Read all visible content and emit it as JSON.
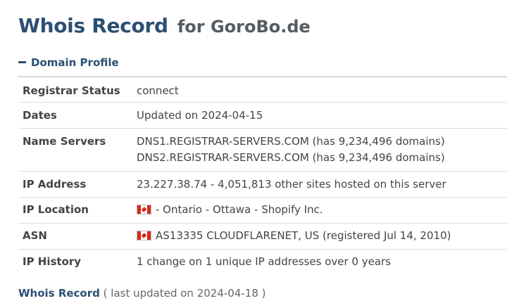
{
  "title": {
    "main": "Whois Record",
    "sub": "for GoroBo.de"
  },
  "section": {
    "label": "Domain Profile",
    "icon": "minus-icon"
  },
  "rows": {
    "registrar_status": {
      "label": "Registrar Status",
      "value": "connect"
    },
    "dates": {
      "label": "Dates",
      "value": "Updated on 2024-04-15"
    },
    "name_servers": {
      "label": "Name Servers",
      "values": [
        "DNS1.REGISTRAR-SERVERS.COM (has 9,234,496 domains)",
        "DNS2.REGISTRAR-SERVERS.COM (has 9,234,496 domains)"
      ]
    },
    "ip_address": {
      "label": "IP Address",
      "value": "23.227.38.74 - 4,051,813 other sites hosted on this server"
    },
    "ip_location": {
      "label": "IP Location",
      "value": "- Ontario - Ottawa - Shopify Inc.",
      "flag": "canada-flag-icon"
    },
    "asn": {
      "label": "ASN",
      "value": "AS13335 CLOUDFLARENET, US (registered Jul 14, 2010)",
      "flag": "canada-flag-icon"
    },
    "ip_history": {
      "label": "IP History",
      "value": "1 change on 1 unique IP addresses over 0 years"
    }
  },
  "footer": {
    "link": "Whois Record",
    "updated": "( last updated on 2024-04-18 )"
  },
  "colors": {
    "heading": "#2c4f73",
    "text": "#444444",
    "flag_red": "#d52b1e"
  }
}
